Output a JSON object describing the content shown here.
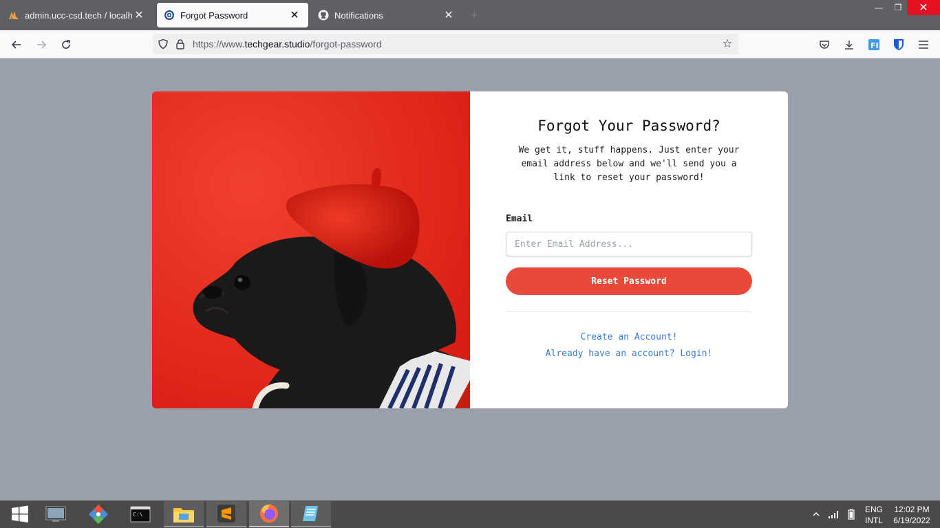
{
  "browser": {
    "tabs": [
      {
        "label": "admin.ucc-csd.tech / localhost",
        "active": false,
        "icon": "phpmyadmin-icon"
      },
      {
        "label": "Forgot Password",
        "active": true,
        "icon": "gear-logo-icon"
      },
      {
        "label": "Notifications",
        "active": false,
        "icon": "github-icon"
      }
    ],
    "new_tab_label": "+",
    "url_prefix": "https://www.",
    "url_domain": "techgear.studio",
    "url_path": "/forgot-password"
  },
  "page": {
    "title": "Forgot Your Password?",
    "subtitle": "We get it, stuff happens. Just enter your email address below and we'll send you a link to reset your password!",
    "email_label": "Email",
    "email_placeholder": "Enter Email Address...",
    "email_value": "",
    "reset_button": "Reset Password",
    "create_account_link": "Create an Account!",
    "login_link": "Already have an account? Login!",
    "colors": {
      "accent": "#e74a3b",
      "link": "#3a7bd5",
      "background": "#9aa0ab",
      "photo_background": "#e5281b"
    }
  },
  "taskbar": {
    "apps": [
      "start-icon",
      "desktop-icon",
      "git-icon",
      "terminal-icon",
      "file-explorer-icon",
      "sublime-text-icon",
      "firefox-icon",
      "notepad-icon"
    ],
    "language_top": "ENG",
    "language_bottom": "INTL",
    "time": "12:02 PM",
    "date": "6/19/2022"
  }
}
